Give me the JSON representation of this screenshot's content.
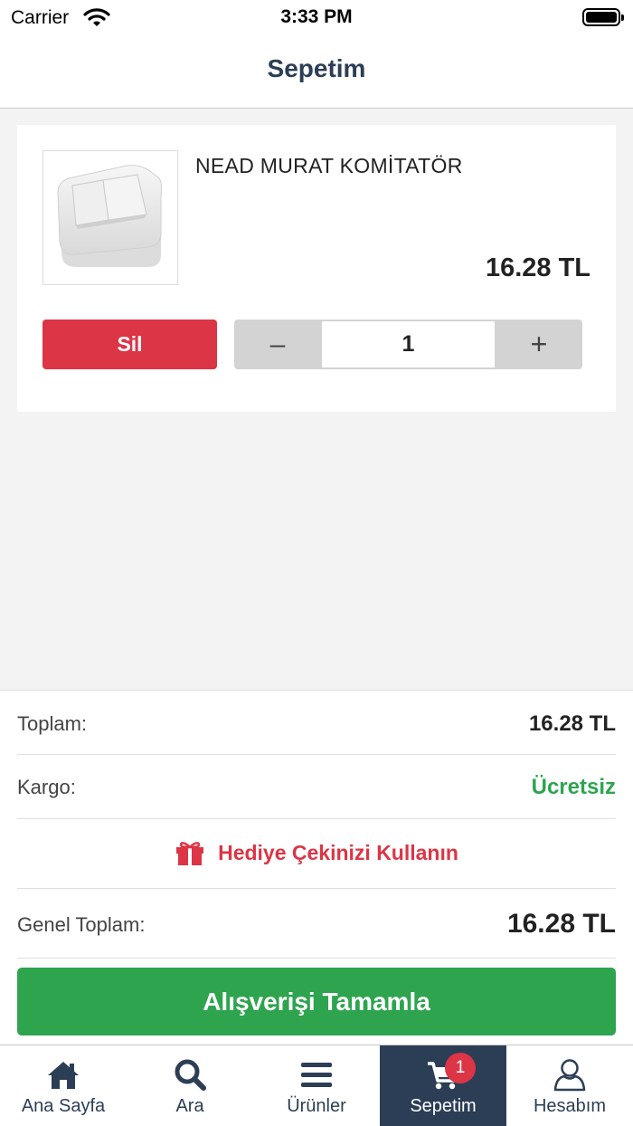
{
  "status_bar": {
    "carrier": "Carrier",
    "time": "3:33 PM"
  },
  "header": {
    "title": "Sepetim"
  },
  "cart": {
    "items": [
      {
        "name": "NEAD MURAT KOMİTATÖR",
        "price": "16.28 TL",
        "quantity": "1",
        "delete_label": "Sil",
        "minus_label": "–",
        "plus_label": "+"
      }
    ]
  },
  "summary": {
    "total_label": "Toplam:",
    "total_value": "16.28 TL",
    "shipping_label": "Kargo:",
    "shipping_value": "Ücretsiz",
    "gift_label": "Hediye Çekinizi Kullanın",
    "grand_total_label": "Genel Toplam:",
    "grand_total_value": "16.28 TL",
    "checkout_label": "Alışverişi Tamamla"
  },
  "tab_bar": {
    "tabs": [
      {
        "label": "Ana Sayfa",
        "icon": "home-icon"
      },
      {
        "label": "Ara",
        "icon": "search-icon"
      },
      {
        "label": "Ürünler",
        "icon": "menu-icon"
      },
      {
        "label": "Sepetim",
        "icon": "cart-icon",
        "badge": "1",
        "active": true
      },
      {
        "label": "Hesabım",
        "icon": "user-icon"
      }
    ]
  },
  "colors": {
    "primary": "#2c3e56",
    "danger": "#dc3545",
    "success": "#2ea44f",
    "background": "#f3f3f3"
  }
}
